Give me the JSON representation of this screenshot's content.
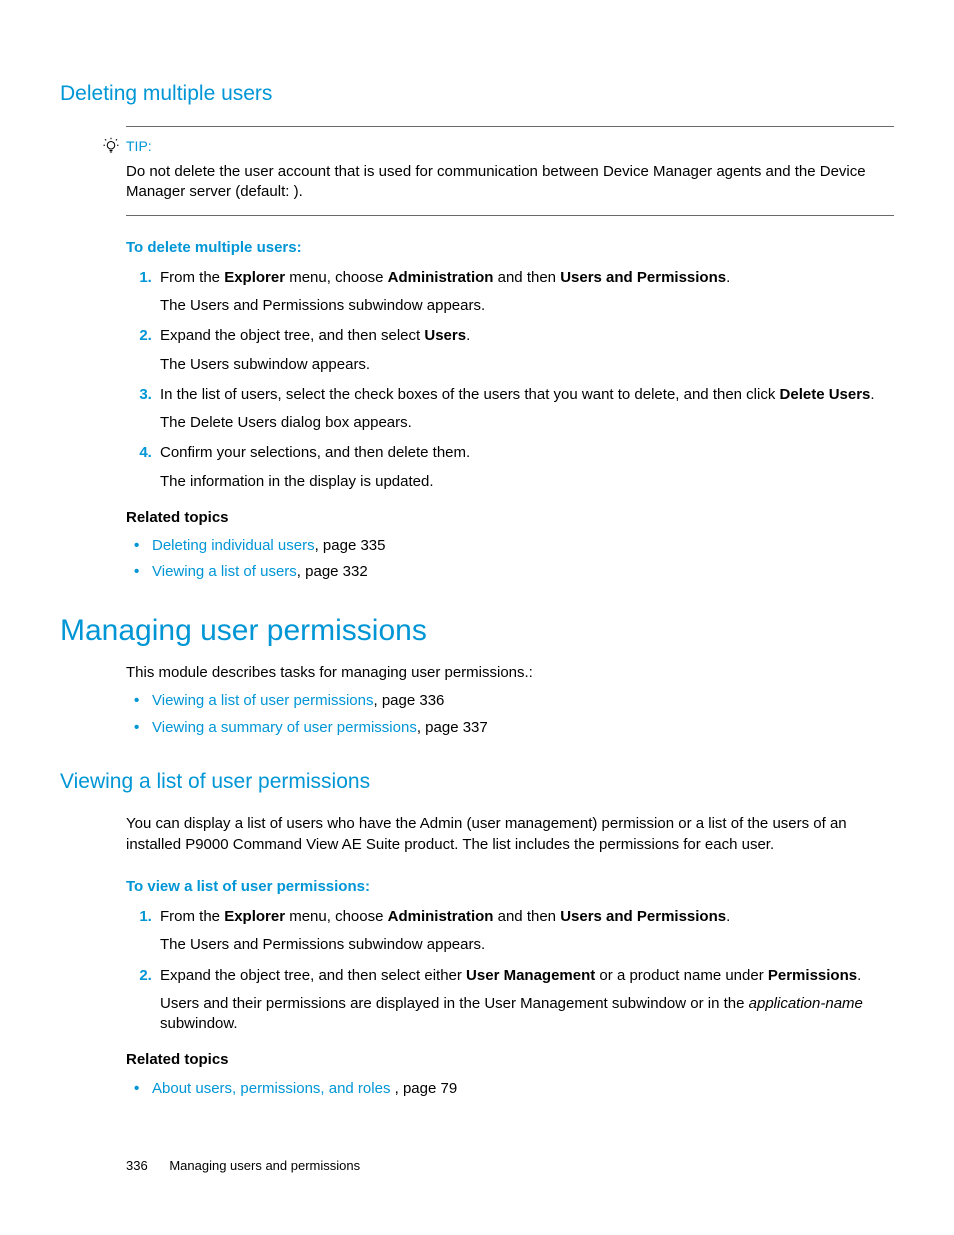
{
  "section1": {
    "title": "Deleting multiple users",
    "tip": {
      "label": "TIP:",
      "text_a": "Do not delete the user account that is used for communication between Device Manager agents and the Device Manager server (default: ",
      "text_b": ")."
    },
    "procedure_title": "To delete multiple users:",
    "steps": {
      "s1a": "From the ",
      "s1_explorer": "Explorer",
      "s1b": " menu, choose ",
      "s1_admin": "Administration",
      "s1c": " and then ",
      "s1_users": "Users and Permissions",
      "s1d": ".",
      "s1_follow": "The Users and Permissions subwindow appears.",
      "s2a": "Expand the object tree, and then select ",
      "s2_users": "Users",
      "s2b": ".",
      "s2_follow": "The Users subwindow appears.",
      "s3a": "In the list of users, select the check boxes of the users that you want to delete, and then click ",
      "s3_del": "Delete Users",
      "s3b": ".",
      "s3_follow": "The Delete Users dialog box appears.",
      "s4a": "Confirm your selections, and then delete them.",
      "s4_follow": "The information in the display is updated."
    },
    "related_title": "Related topics",
    "related": {
      "r1_link": "Deleting individual users",
      "r1_page": ", page 335",
      "r2_link": "Viewing a list of users",
      "r2_page": ", page 332"
    }
  },
  "section2": {
    "title": "Managing user permissions",
    "intro": "This module describes tasks for managing user permissions.:",
    "links": {
      "l1": "Viewing a list of user permissions",
      "l1_page": ", page 336",
      "l2": "Viewing a summary of user permissions",
      "l2_page": ", page 337"
    }
  },
  "section3": {
    "title": "Viewing a list of user permissions",
    "intro": "You can display a list of users who have the Admin (user management) permission or a list of the users of an installed P9000 Command View AE Suite product. The list includes the permissions for each user.",
    "procedure_title": "To view a list of user permissions:",
    "steps": {
      "s1a": "From the ",
      "s1_explorer": "Explorer",
      "s1b": " menu, choose ",
      "s1_admin": "Administration",
      "s1c": " and then ",
      "s1_users": "Users and Permissions",
      "s1d": ".",
      "s1_follow": "The Users and Permissions subwindow appears.",
      "s2a": "Expand the object tree, and then select either ",
      "s2_um": "User Management",
      "s2b": " or a product name under ",
      "s2_perm": "Permissions",
      "s2c": ".",
      "s2_follow_a": "Users and their permissions are displayed in the User Management subwindow or in the ",
      "s2_follow_i": "application-name",
      "s2_follow_b": " subwindow."
    },
    "related_title": "Related topics",
    "related": {
      "r1_link": "About users, permissions, and roles ",
      "r1_page": ", page 79"
    }
  },
  "footer": {
    "page_number": "336",
    "chapter": "Managing users and permissions"
  }
}
